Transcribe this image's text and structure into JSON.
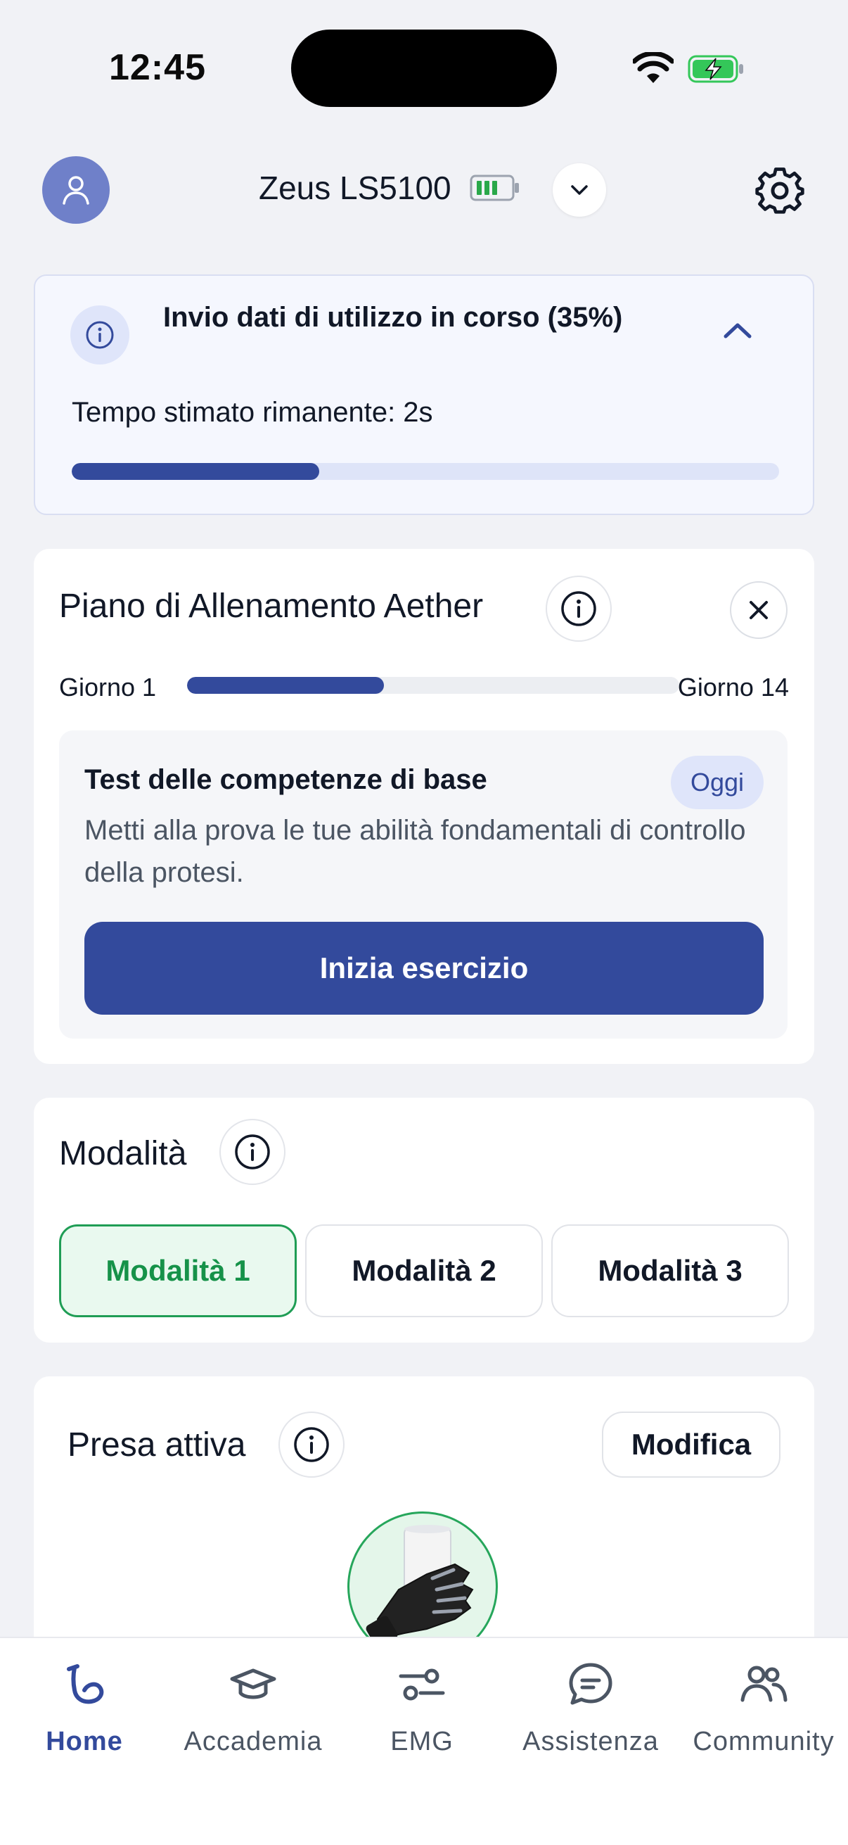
{
  "status_bar": {
    "time": "12:45"
  },
  "header": {
    "device_name": "Zeus LS5100"
  },
  "upload": {
    "title": "Invio dati di utilizzo in corso (35%)",
    "eta": "Tempo stimato rimanente: 2s",
    "progress": 0.35
  },
  "training": {
    "title": "Piano di Allenamento Aether",
    "day_start": "Giorno 1",
    "day_end": "Giorno 14",
    "progress": 0.4,
    "exercise": {
      "title": "Test delle competenze di base",
      "badge": "Oggi",
      "description": "Metti alla prova le tue abilità fondamentali di controllo della protesi.",
      "button": "Inizia esercizio"
    }
  },
  "modes": {
    "title": "Modalità",
    "items": [
      "Modalità 1",
      "Modalità 2",
      "Modalità 3"
    ],
    "selected_index": 0
  },
  "grip": {
    "title": "Presa attiva",
    "edit_label": "Modifica"
  },
  "nav": {
    "items": [
      {
        "label": "Home",
        "icon": "home-arm-icon",
        "active": true
      },
      {
        "label": "Accademia",
        "icon": "graduation-cap-icon",
        "active": false
      },
      {
        "label": "EMG",
        "icon": "emg-sliders-icon",
        "active": false
      },
      {
        "label": "Assistenza",
        "icon": "chat-bubble-icon",
        "active": false
      },
      {
        "label": "Community",
        "icon": "people-icon",
        "active": false
      }
    ]
  },
  "colors": {
    "primary": "#334a9c",
    "success": "#1f9d55",
    "background": "#f1f2f6"
  }
}
